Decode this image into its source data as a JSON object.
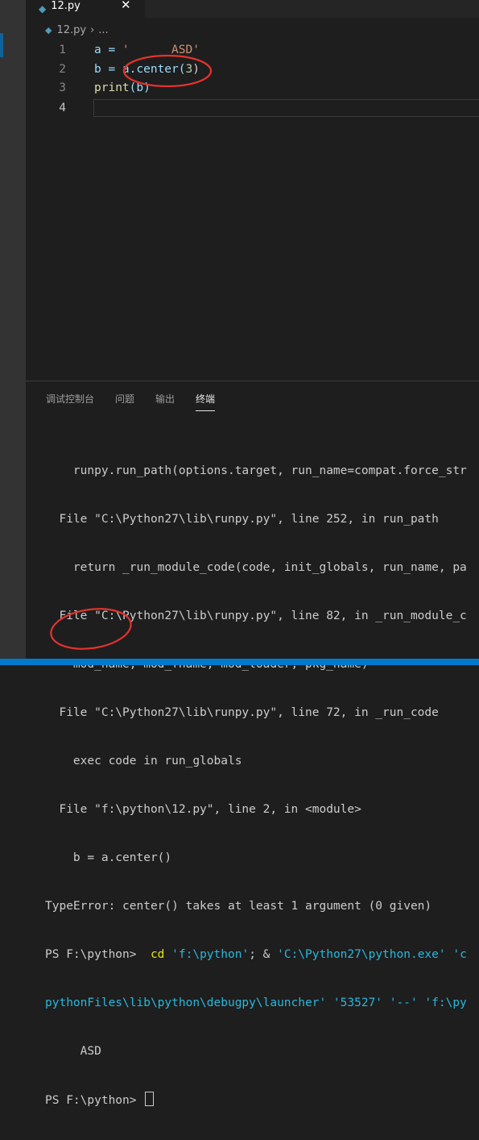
{
  "tab": {
    "filename": "12.py",
    "close_glyph": "✕"
  },
  "breadcrumb": {
    "file": "12.py",
    "separator": "›",
    "more": "..."
  },
  "editor": {
    "lines": [
      {
        "num": "1",
        "a": "a = ",
        "b": "'      ASD'"
      },
      {
        "num": "2",
        "a": "b = a.center(",
        "b": "3",
        "c": ")"
      },
      {
        "num": "3",
        "a": "print",
        "b": "(b)"
      },
      {
        "num": "4"
      }
    ]
  },
  "panel": {
    "tabs": [
      "调试控制台",
      "问题",
      "输出",
      "终端"
    ],
    "active_tab": 3
  },
  "terminal": {
    "lines": [
      "    runpy.run_path(options.target, run_name=compat.force_str",
      "  File \"C:\\Python27\\lib\\runpy.py\", line 252, in run_path",
      "    return _run_module_code(code, init_globals, run_name, pa",
      "  File \"C:\\Python27\\lib\\runpy.py\", line 82, in _run_module_c",
      "    mod_name, mod_fname, mod_loader, pkg_name)",
      "  File \"C:\\Python27\\lib\\runpy.py\", line 72, in _run_code",
      "    exec code in run_globals",
      "  File \"f:\\python\\12.py\", line 2, in <module>",
      "    b = a.center()",
      "TypeError: center() takes at least 1 argument (0 given)"
    ],
    "cmd_prompt": "PS F:\\python> ",
    "cmd_cd": " cd",
    "cmd_path": " 'f:\\python'",
    "cmd_sep": "; & ",
    "cmd_exe": "'C:\\Python27\\python.exe' 'c",
    "cmd_wrap": "pythonFiles\\lib\\python\\debugpy\\launcher' '53527' '--' 'f:\\py",
    "output": "     ASD",
    "final_prompt": "PS F:\\python> "
  },
  "colors": {
    "annotation": "#e5322d",
    "accent": "#007acc"
  }
}
